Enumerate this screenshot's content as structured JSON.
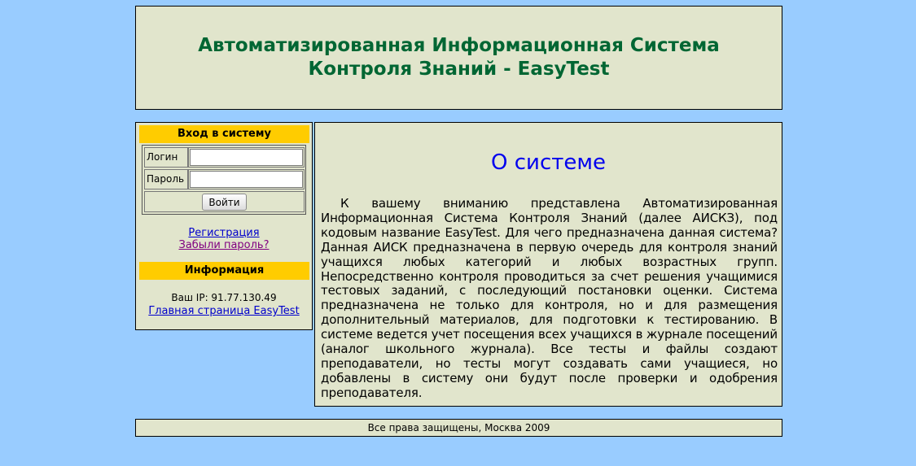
{
  "header": {
    "title_line1": "Автоматизированная Информационная Система",
    "title_line2": "Контроля Знаний - EasyTest"
  },
  "login": {
    "heading": "Вход в систему",
    "login_label": "Логин",
    "login_value": "",
    "password_label": "Пароль",
    "password_value": "",
    "submit_label": "Войти"
  },
  "links": {
    "register": "Регистрация",
    "forgot_password": "Забыли пароль?"
  },
  "info": {
    "heading": "Информация",
    "ip_text": "Ваш IP: 91.77.130.49",
    "home_link": "Главная страница EasyTest"
  },
  "main": {
    "title": "О системе",
    "body": "К вашему вниманию представлена Автоматизированная Информационная Система Контроля Знаний (далее АИСКЗ), под кодовым название EasyTest. Для чего предназначена данная система? Данная АИСК предназначена в первую очередь для контроля знаний учащихся любых категорий и любых возрастных групп. Непосредственно контроля проводиться за счет решения учащимися тестовых заданий, с последующий постановки оценки. Система предназначена не только для контроля, но и для размещения дополнительный материалов, для подготовки к тестированию. В системе ведется учет посещения всех учащихся в журнале посещений (аналог школьного журнала). Все тесты и файлы создают преподаватели, но тесты могут создавать сами учащиеся, но добавлены в систему они будут после проверки и одобрения преподавателя."
  },
  "footer": {
    "copyright": "Все права защищены, Москва 2009"
  },
  "colors": {
    "page_background": "#99ccff",
    "panel_background": "#e1e5cc",
    "header_text": "#006633",
    "section_header": "#ffcc00",
    "title_blue": "#0000ee",
    "link_blue": "#0000cc",
    "visited_link": "#800080"
  }
}
